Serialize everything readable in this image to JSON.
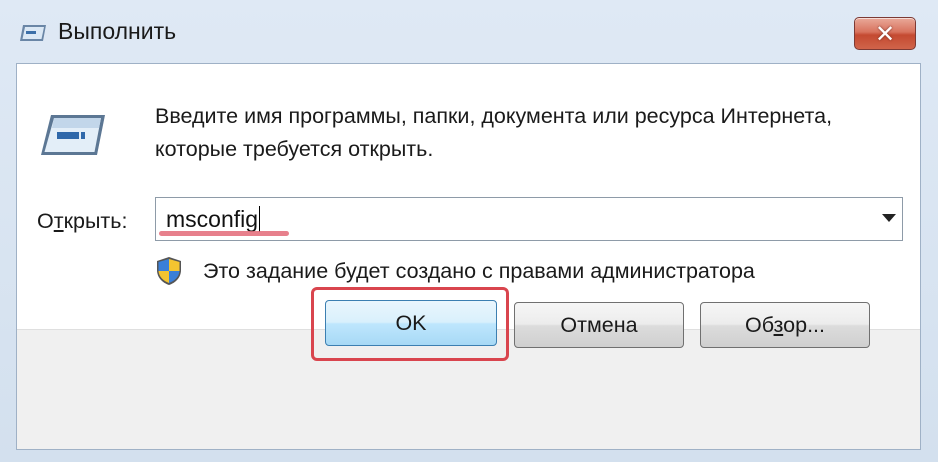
{
  "window": {
    "title": "Выполнить",
    "close_symbol": "✕",
    "icons": {
      "title": "run-dialog-icon",
      "close": "close-icon"
    }
  },
  "dialog": {
    "description": "Введите имя программы, папки, документа или ресурса Интернета, которые требуется открыть.",
    "open_label_prefix": "О",
    "open_label_underlined": "т",
    "open_label_suffix": "крыть:",
    "open_value": "msconfig",
    "admin_note": "Это задание будет создано с правами администратора",
    "icons": {
      "run": "run-program-icon",
      "shield": "uac-shield-icon",
      "dropdown": "chevron-down-icon"
    }
  },
  "buttons": {
    "ok": "OK",
    "cancel": "Отмена",
    "browse_prefix": "Об",
    "browse_underlined": "з",
    "browse_suffix": "ор..."
  },
  "colors": {
    "highlight": "#d9454e",
    "input_underline": "#e36a78",
    "close_button": "#c44a31"
  }
}
